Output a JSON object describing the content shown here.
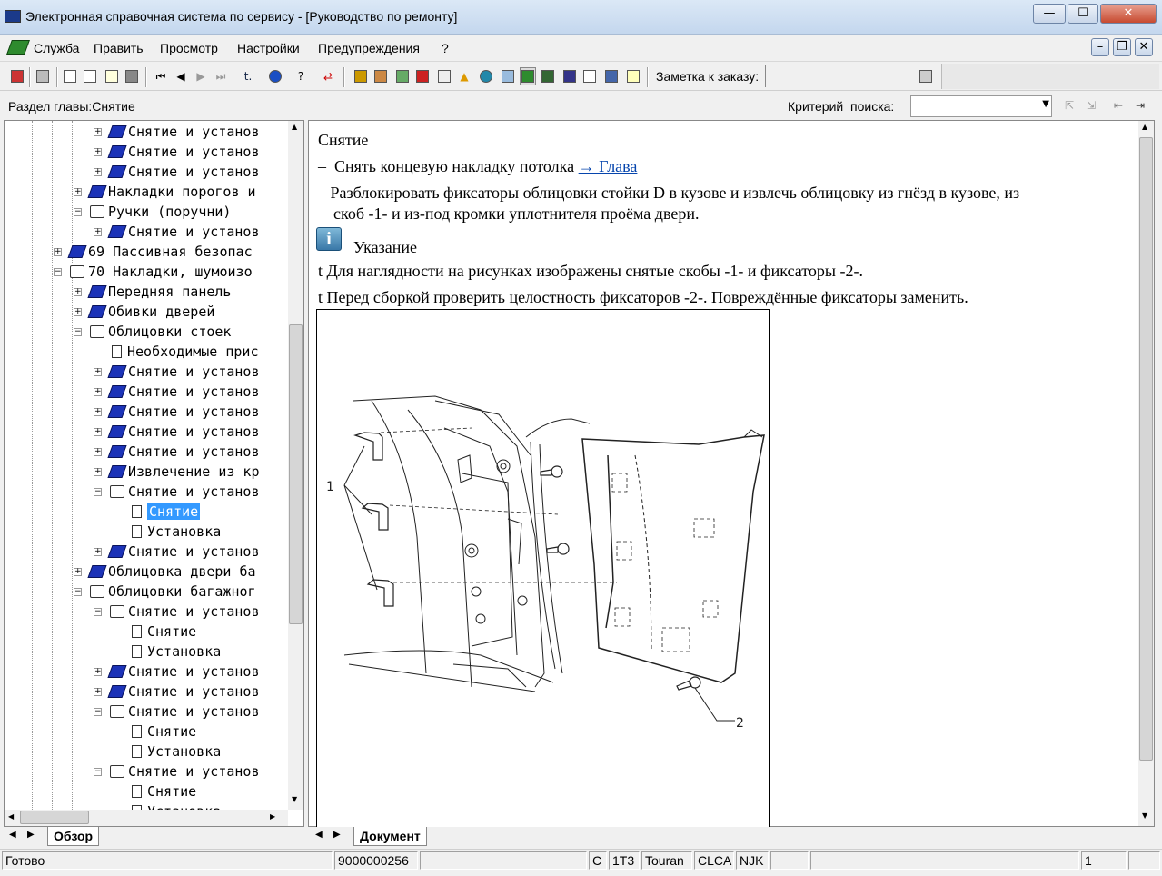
{
  "window": {
    "title": "Электронная справочная система по сервису - [Руководство по ремонту]",
    "controls": [
      "—",
      "☐",
      "✕"
    ]
  },
  "menu": {
    "items": [
      "Служба",
      "Править",
      "Просмотр",
      "Настройки",
      "Предупреждения",
      "?"
    ]
  },
  "toolbar": {
    "order_note_label": "Заметка к заказу:"
  },
  "section": {
    "chapter_label": "Раздел главы:Снятие",
    "search_label": "Критерий  поиска:",
    "search_value": ""
  },
  "tree": {
    "rows": [
      {
        "text": "Снятие и установ",
        "level": 2,
        "icon": "book",
        "toggle": "+"
      },
      {
        "text": "Снятие и установ",
        "level": 2,
        "icon": "book",
        "toggle": "+"
      },
      {
        "text": "Снятие и установ",
        "level": 2,
        "icon": "book",
        "toggle": "+"
      },
      {
        "text": "Накладки порогов и",
        "level": 1,
        "icon": "book",
        "toggle": "+"
      },
      {
        "text": "Ручки (поручни)",
        "level": 1,
        "icon": "open-book",
        "toggle": "-"
      },
      {
        "text": "Снятие и установ",
        "level": 2,
        "icon": "book",
        "toggle": "+"
      },
      {
        "text": "69 Пассивная безопас",
        "level": 0,
        "icon": "book",
        "toggle": "+"
      },
      {
        "text": "70 Накладки, шумоизо",
        "level": 0,
        "icon": "open-book",
        "toggle": "-"
      },
      {
        "text": "Передняя панель",
        "level": 1,
        "icon": "book",
        "toggle": "+"
      },
      {
        "text": "Обивки дверей",
        "level": 1,
        "icon": "book",
        "toggle": "+"
      },
      {
        "text": "Облицовки стоек",
        "level": 1,
        "icon": "open-book",
        "toggle": "-"
      },
      {
        "text": "Необходимые прис",
        "level": 2,
        "icon": "page",
        "toggle": ""
      },
      {
        "text": "Снятие и установ",
        "level": 2,
        "icon": "book",
        "toggle": "+"
      },
      {
        "text": "Снятие и установ",
        "level": 2,
        "icon": "book",
        "toggle": "+"
      },
      {
        "text": "Снятие и установ",
        "level": 2,
        "icon": "book",
        "toggle": "+"
      },
      {
        "text": "Снятие и установ",
        "level": 2,
        "icon": "book",
        "toggle": "+"
      },
      {
        "text": "Снятие и установ",
        "level": 2,
        "icon": "book",
        "toggle": "+"
      },
      {
        "text": "Извлечение из кр",
        "level": 2,
        "icon": "book",
        "toggle": "+"
      },
      {
        "text": "Снятие и установ",
        "level": 2,
        "icon": "open-book",
        "toggle": "-"
      },
      {
        "text": "Снятие",
        "level": 3,
        "icon": "page",
        "toggle": "",
        "selected": true
      },
      {
        "text": "Установка",
        "level": 3,
        "icon": "page",
        "toggle": ""
      },
      {
        "text": "Снятие и установ",
        "level": 2,
        "icon": "book",
        "toggle": "+"
      },
      {
        "text": "Облицовка двери ба",
        "level": 1,
        "icon": "book",
        "toggle": "+"
      },
      {
        "text": "Облицовки багажног",
        "level": 1,
        "icon": "open-book",
        "toggle": "-"
      },
      {
        "text": "Снятие и установ",
        "level": 2,
        "icon": "open-book",
        "toggle": "-"
      },
      {
        "text": "Снятие",
        "level": 3,
        "icon": "page",
        "toggle": ""
      },
      {
        "text": "Установка",
        "level": 3,
        "icon": "page",
        "toggle": ""
      },
      {
        "text": "Снятие и установ",
        "level": 2,
        "icon": "book",
        "toggle": "+"
      },
      {
        "text": "Снятие и установ",
        "level": 2,
        "icon": "book",
        "toggle": "+"
      },
      {
        "text": "Снятие и установ",
        "level": 2,
        "icon": "open-book",
        "toggle": "-"
      },
      {
        "text": "Снятие",
        "level": 3,
        "icon": "page",
        "toggle": ""
      },
      {
        "text": "Установка",
        "level": 3,
        "icon": "page",
        "toggle": ""
      },
      {
        "text": "Снятие и установ",
        "level": 2,
        "icon": "open-book",
        "toggle": "-"
      },
      {
        "text": "Снятие",
        "level": 3,
        "icon": "page",
        "toggle": ""
      },
      {
        "text": "Установка",
        "level": 3,
        "icon": "page",
        "toggle": ""
      }
    ]
  },
  "document": {
    "heading": "Снятие",
    "step1_prefix": "–  Снять концевую накладку потолка ",
    "step1_link": "→ Глава",
    "step2_line1": "–  Разблокировать фиксаторы облицовки стойки D в кузове и извлечь облицовку из гнёзд в кузове, из",
    "step2_line2": "скоб -1- и из-под кромки уплотнителя проёма двери.",
    "note_title": "Указание",
    "bullet1": "t  Для наглядности на рисунках изображены снятые скобы -1- и фиксаторы -2-.",
    "bullet2": "t  Перед сборкой проверить целостность фиксаторов -2-. Повреждённые фиксаторы заменить.",
    "figure_label_1": "1",
    "figure_label_2": "2"
  },
  "tabs": {
    "left": "Обзор",
    "right": "Документ"
  },
  "status": {
    "ready": "Готово",
    "order_number": "9000000256",
    "c": "C",
    "model_code": "1T3",
    "model": "Touran",
    "engine": "CLCA",
    "gearbox": "NJK",
    "page": "1"
  }
}
